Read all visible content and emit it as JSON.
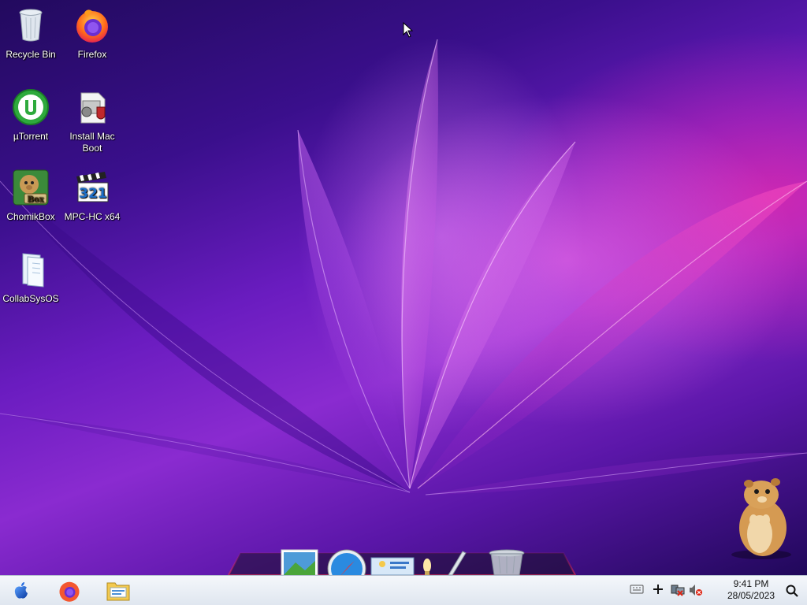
{
  "desktop": {
    "icons": [
      {
        "label": "Recycle Bin",
        "icon": "recycle-bin-icon"
      },
      {
        "label": "Firefox",
        "icon": "firefox-icon"
      },
      {
        "label": "µTorrent",
        "icon": "utorrent-icon"
      },
      {
        "label": "Install Mac Boot",
        "icon": "install-mac-boot-icon"
      },
      {
        "label": "ChomikBox",
        "icon": "chomikbox-icon"
      },
      {
        "label": "MPC-HC x64",
        "icon": "mpc-hc-icon"
      },
      {
        "label": "CollabSysOS",
        "icon": "folder-icon"
      }
    ],
    "chomikbox_badge": "Box",
    "mpc_badge": "321"
  },
  "dock": {
    "items": [
      "photos-icon",
      "safari-icon",
      "mail-icon",
      "lamp-icon",
      "pen-icon",
      "trash-icon"
    ]
  },
  "taskbar": {
    "pinned": [
      "apple-menu-icon",
      "firefox-icon",
      "file-explorer-icon"
    ],
    "tray": [
      "keyboard-icon",
      "plus-icon",
      "network-disconnected-icon",
      "volume-muted-icon"
    ],
    "time": "9:41 PM",
    "date": "28/05/2023",
    "search_icon": "search-icon"
  }
}
